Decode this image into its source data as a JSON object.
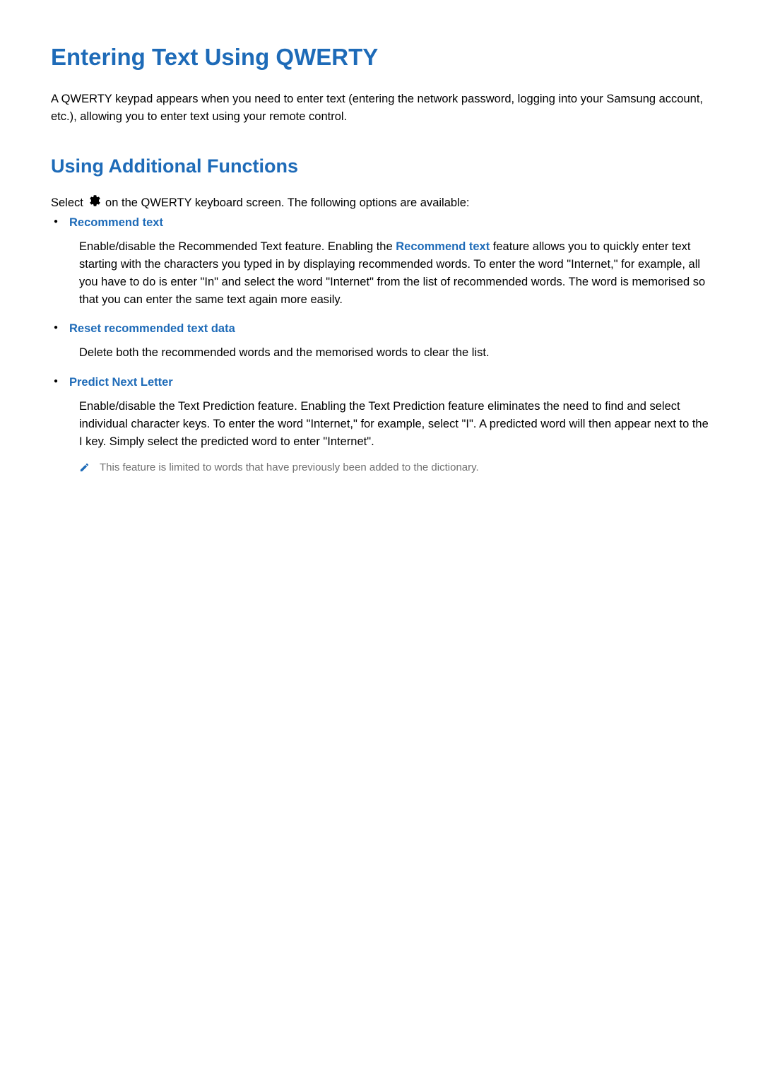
{
  "title": "Entering Text Using QWERTY",
  "intro": "A QWERTY keypad appears when you need to enter text (entering the network password, logging into your Samsung account, etc.), allowing you to enter text using your remote control.",
  "section_title": "Using Additional Functions",
  "select_before": "Select ",
  "select_after": " on the QWERTY keyboard screen. The following options are available:",
  "items": [
    {
      "title": "Recommend text",
      "body_before": "Enable/disable the Recommended Text feature. Enabling the ",
      "body_highlight": "Recommend text",
      "body_after": " feature allows you to quickly enter text starting with the characters you typed in by displaying recommended words. To enter the word \"Internet,\" for example, all you have to do is enter \"In\" and select the word \"Internet\" from the list of recommended words. The word is memorised so that you can enter the same text again more easily."
    },
    {
      "title": "Reset recommended text data",
      "body": "Delete both the recommended words and the memorised words to clear the list."
    },
    {
      "title": "Predict Next Letter",
      "body": "Enable/disable the Text Prediction feature. Enabling the Text Prediction feature eliminates the need to find and select individual character keys. To enter the word \"Internet,\" for example, select \"I\". A predicted word will then appear next to the I key. Simply select the predicted word to enter \"Internet\".",
      "note": "This feature is limited to words that have previously been added to the dictionary."
    }
  ]
}
